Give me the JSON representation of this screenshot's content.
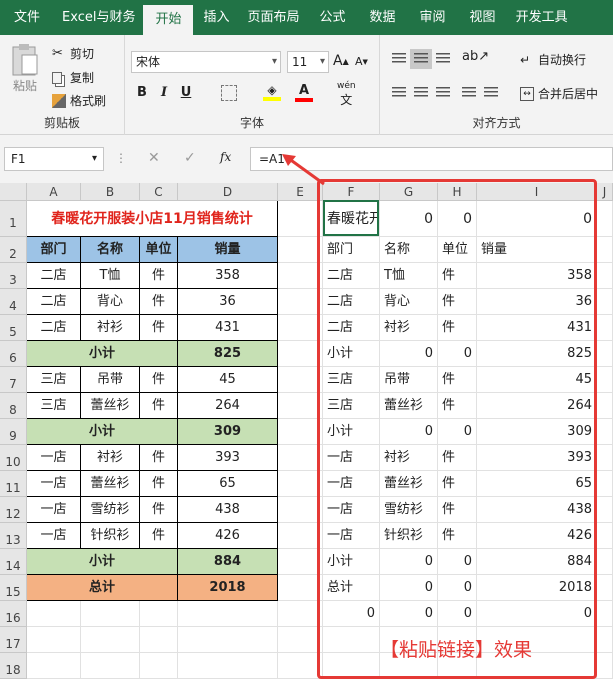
{
  "tabs": [
    "文件",
    "Excel与财务",
    "开始",
    "插入",
    "页面布局",
    "公式",
    "数据",
    "审阅",
    "视图",
    "开发工具"
  ],
  "ribbon": {
    "paste": "粘贴",
    "cut": "剪切",
    "copy": "复制",
    "format_painter": "格式刷",
    "clipboard_label": "剪贴板",
    "font_name": "宋体",
    "font_size": "11",
    "bold": "B",
    "italic": "I",
    "underline": "U",
    "wen": "wén",
    "font_label": "字体",
    "wrap": "自动换行",
    "merge": "合并后居中",
    "align_label": "对齐方式"
  },
  "formula_bar": {
    "name_box": "F1",
    "formula": "=A1",
    "fx": "fx"
  },
  "columns": [
    "A",
    "B",
    "C",
    "D",
    "E",
    "F",
    "G",
    "H",
    "I",
    "J"
  ],
  "rows": [
    "1",
    "2",
    "3",
    "4",
    "5",
    "6",
    "7",
    "8",
    "9",
    "10",
    "11",
    "12",
    "13",
    "14",
    "15",
    "16",
    "17",
    "18"
  ],
  "table": {
    "title": "春暖花开服装小店11月销售统计",
    "headers": [
      "部门",
      "名称",
      "单位",
      "销量"
    ],
    "rows": [
      [
        "二店",
        "T恤",
        "件",
        "358"
      ],
      [
        "二店",
        "背心",
        "件",
        "36"
      ],
      [
        "二店",
        "衬衫",
        "件",
        "431"
      ],
      [
        "小计",
        "",
        "",
        "825"
      ],
      [
        "三店",
        "吊带",
        "件",
        "45"
      ],
      [
        "三店",
        "蕾丝衫",
        "件",
        "264"
      ],
      [
        "小计",
        "",
        "",
        "309"
      ],
      [
        "一店",
        "衬衫",
        "件",
        "393"
      ],
      [
        "一店",
        "蕾丝衫",
        "件",
        "65"
      ],
      [
        "一店",
        "雪纺衫",
        "件",
        "438"
      ],
      [
        "一店",
        "针织衫",
        "件",
        "426"
      ],
      [
        "小计",
        "",
        "",
        "884"
      ],
      [
        "总计",
        "",
        "",
        "2018"
      ]
    ]
  },
  "linked": {
    "rows": [
      [
        "春暖花开",
        "0",
        "0",
        "0"
      ],
      [
        "部门",
        "名称",
        "单位",
        "销量"
      ],
      [
        "二店",
        "T恤",
        "件",
        "358"
      ],
      [
        "二店",
        "背心",
        "件",
        "36"
      ],
      [
        "二店",
        "衬衫",
        "件",
        "431"
      ],
      [
        "小计",
        "0",
        "0",
        "825"
      ],
      [
        "三店",
        "吊带",
        "件",
        "45"
      ],
      [
        "三店",
        "蕾丝衫",
        "件",
        "264"
      ],
      [
        "小计",
        "0",
        "0",
        "309"
      ],
      [
        "一店",
        "衬衫",
        "件",
        "393"
      ],
      [
        "一店",
        "蕾丝衫",
        "件",
        "65"
      ],
      [
        "一店",
        "雪纺衫",
        "件",
        "438"
      ],
      [
        "一店",
        "针织衫",
        "件",
        "426"
      ],
      [
        "小计",
        "0",
        "0",
        "884"
      ],
      [
        "总计",
        "0",
        "0",
        "2018"
      ],
      [
        "0",
        "0",
        "0",
        "0"
      ]
    ]
  },
  "caption": "【粘贴链接】效果",
  "colors": {
    "excel_green": "#217346",
    "title_red": "#e0241c",
    "header_blue": "#9dc3e6",
    "subtotal_green": "#c6e0b4",
    "total_orange": "#f4b183",
    "annotation_red": "#e53935"
  }
}
